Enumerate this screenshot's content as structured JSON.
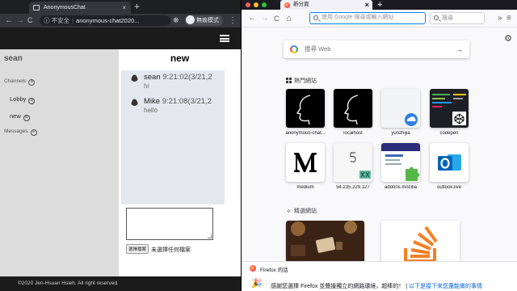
{
  "chrome": {
    "tab_title": "AnonymousChat",
    "tab_close": "×",
    "new_tab": "+",
    "back": "←",
    "forward": "→",
    "reload": "C",
    "security_label": "不安全",
    "url": "anonymous-chat2020...",
    "incognito_label": "無痕模式",
    "menu": "⋮"
  },
  "app": {
    "user": "sean",
    "sections": {
      "channels": "Channels",
      "messages": "Messages",
      "add": "+"
    },
    "channels": [
      {
        "name": "Lobby",
        "action": "×"
      },
      {
        "name": "new",
        "action": "×"
      }
    ],
    "channel_title": "new",
    "messages": [
      {
        "author": "sean",
        "time": "9:21:02(3/21,2",
        "text": "hi"
      },
      {
        "author": "Mike",
        "time": "9:21:08(3/21,2",
        "text": "hello"
      }
    ],
    "file_button": "選擇檔案",
    "file_status": "未選擇任何檔案",
    "footer": "©2020 Jen-Hsuan Hsieh. All right reserved."
  },
  "firefox": {
    "tab_title": "新分頁",
    "tab_close": "×",
    "new_tab": "+",
    "back": "←",
    "forward": "→",
    "reload": "C",
    "home": "⌂",
    "url_placeholder": "使用 Google 搜尋或輸入網址",
    "search_placeholder": "搜尋",
    "more": "»",
    "menu": "≡",
    "newtab": {
      "settings": "⚙",
      "search_placeholder": "搜尋 Web",
      "search_arrow": "→",
      "top_sites_label": "熱門網站",
      "top_sites": [
        {
          "label": "anonymous-chat..."
        },
        {
          "label": "localhost"
        },
        {
          "label": "yunzhijia"
        },
        {
          "label": "codepen"
        },
        {
          "label": "medium"
        },
        {
          "label": "54.235.229.127"
        },
        {
          "label": "addons.mozilla"
        },
        {
          "label": "outlook.live"
        }
      ],
      "highlights_label": "精選網站"
    },
    "pocket": {
      "title": "Firefox 的話",
      "message": "感謝您選擇 Firefox 並聲援獨立的網路環境，超棒的！",
      "link": "以下是接下來您還能做的事情"
    }
  }
}
